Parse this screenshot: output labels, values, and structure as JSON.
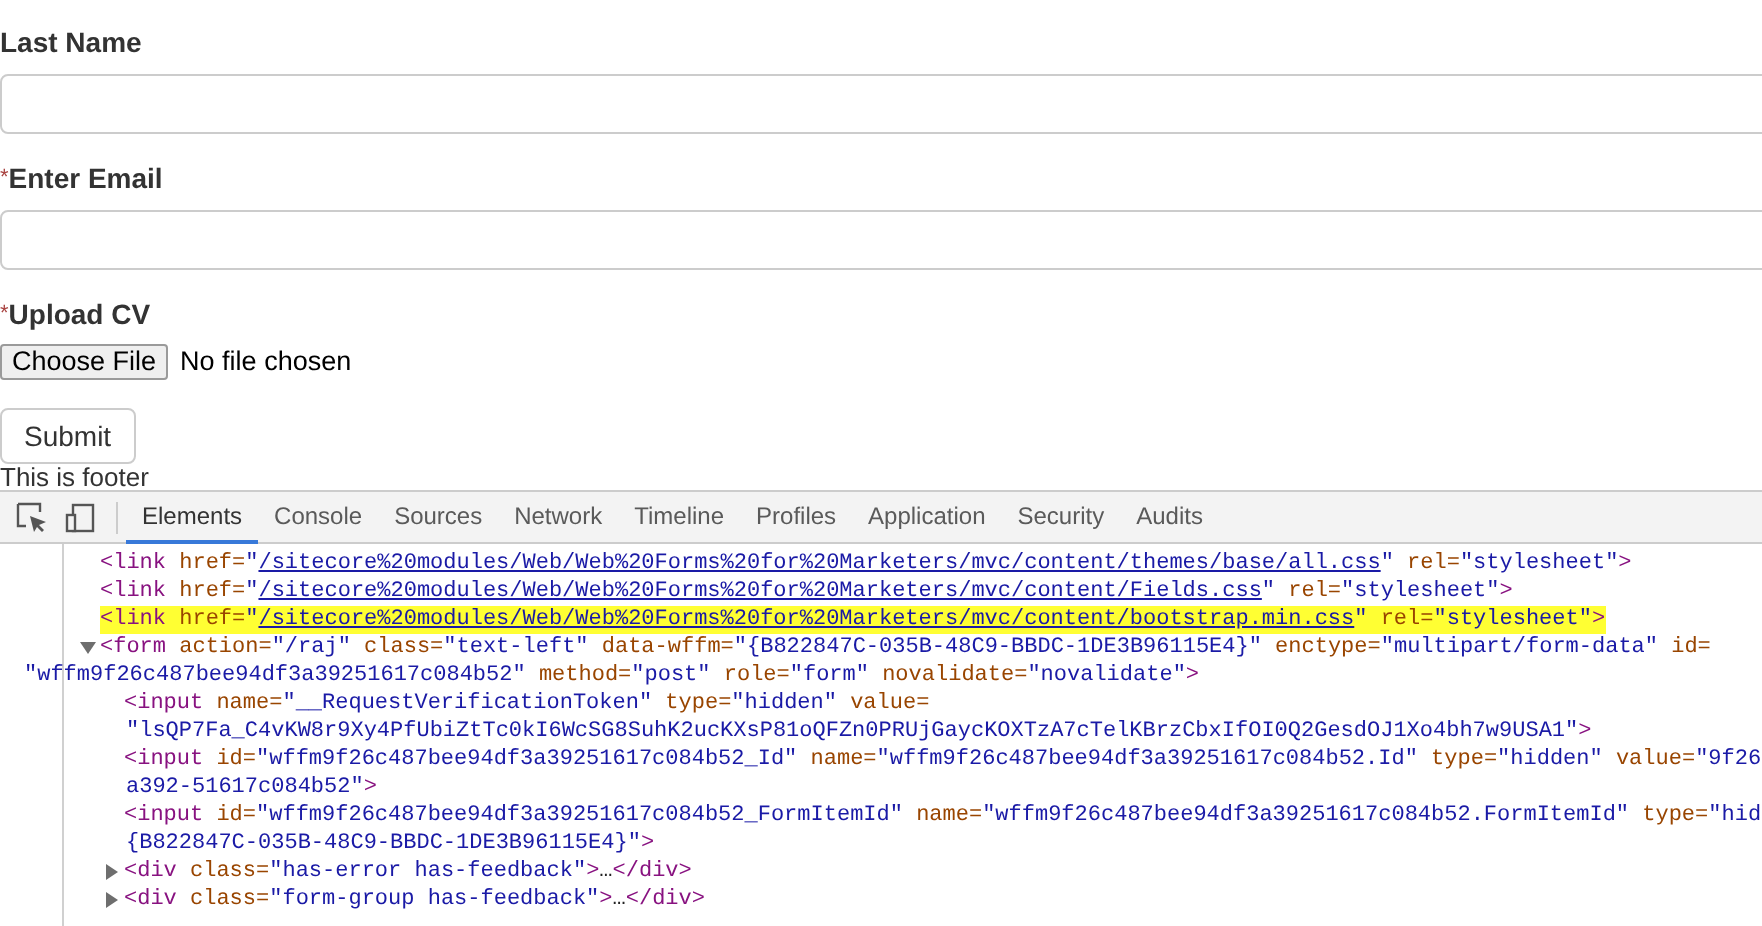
{
  "form": {
    "fields": [
      {
        "kind": "text",
        "label": "Last Name"
      },
      {
        "kind": "text",
        "label": "Enter Email",
        "required_mark": "*"
      },
      {
        "kind": "file",
        "label": "Upload CV",
        "required_mark": "*",
        "button": "Choose File",
        "status": "No file chosen"
      }
    ],
    "submit": "Submit",
    "footer": "This is footer"
  },
  "devtools": {
    "tabs": [
      {
        "label": "Elements",
        "selected": true
      },
      {
        "label": "Console",
        "selected": false
      },
      {
        "label": "Sources",
        "selected": false
      },
      {
        "label": "Network",
        "selected": false
      },
      {
        "label": "Timeline",
        "selected": false
      },
      {
        "label": "Profiles",
        "selected": false
      },
      {
        "label": "Application",
        "selected": false
      },
      {
        "label": "Security",
        "selected": false
      },
      {
        "label": "Audits",
        "selected": false
      }
    ],
    "nodes": [
      {
        "selected": false,
        "lines": [
          [
            {
              "kind": "tag",
              "text": "<link"
            },
            {
              "kind": "attr",
              "text": " href="
            },
            {
              "kind": "value",
              "text": "\""
            },
            {
              "kind": "link",
              "text": "/sitecore%20modules/Web/Web%20Forms%20for%20Marketers/mvc/content/themes/base/all.css"
            },
            {
              "kind": "value",
              "text": "\""
            },
            {
              "kind": "attr",
              "text": " rel="
            },
            {
              "kind": "value",
              "text": "\"stylesheet\""
            },
            {
              "kind": "tag",
              "text": ">"
            }
          ]
        ]
      },
      {
        "selected": false,
        "lines": [
          [
            {
              "kind": "tag",
              "text": "<link"
            },
            {
              "kind": "attr",
              "text": " href="
            },
            {
              "kind": "value",
              "text": "\""
            },
            {
              "kind": "link",
              "text": "/sitecore%20modules/Web/Web%20Forms%20for%20Marketers/mvc/content/Fields.css"
            },
            {
              "kind": "value",
              "text": "\""
            },
            {
              "kind": "attr",
              "text": " rel="
            },
            {
              "kind": "value",
              "text": "\"stylesheet\""
            },
            {
              "kind": "tag",
              "text": ">"
            }
          ]
        ]
      },
      {
        "selected": true,
        "lines": [
          [
            {
              "kind": "tag",
              "text": "<link"
            },
            {
              "kind": "attr",
              "text": " href="
            },
            {
              "kind": "value",
              "text": "\""
            },
            {
              "kind": "link",
              "text": "/sitecore%20modules/Web/Web%20Forms%20for%20Marketers/mvc/content/bootstrap.min.css"
            },
            {
              "kind": "value",
              "text": "\""
            },
            {
              "kind": "attr",
              "text": " rel="
            },
            {
              "kind": "value",
              "text": "\"stylesheet\""
            },
            {
              "kind": "tag",
              "text": ">"
            }
          ]
        ]
      },
      {
        "selected": false,
        "expanded": true,
        "lines": [
          [
            {
              "kind": "tag",
              "text": "<form"
            },
            {
              "kind": "attr",
              "text": " action="
            },
            {
              "kind": "value",
              "text": "\"/raj\""
            },
            {
              "kind": "attr",
              "text": " class="
            },
            {
              "kind": "value",
              "text": "\"text-left\""
            },
            {
              "kind": "attr",
              "text": " data-wffm="
            },
            {
              "kind": "value",
              "text": "\"{B822847C-035B-48C9-BBDC-1DE3B96115E4}\""
            },
            {
              "kind": "attr",
              "text": " enctype="
            },
            {
              "kind": "value",
              "text": "\"multipart/form-data\""
            },
            {
              "kind": "attr",
              "text": " id="
            }
          ],
          [
            {
              "kind": "value",
              "text": "\"wffm9f26c487bee94df3a39251617c084b52\""
            },
            {
              "kind": "attr",
              "text": " method="
            },
            {
              "kind": "value",
              "text": "\"post\""
            },
            {
              "kind": "attr",
              "text": " role="
            },
            {
              "kind": "value",
              "text": "\"form\""
            },
            {
              "kind": "attr",
              "text": " novalidate="
            },
            {
              "kind": "value",
              "text": "\"novalidate\""
            },
            {
              "kind": "tag",
              "text": ">"
            }
          ]
        ],
        "children": [
          {
            "selected": false,
            "lines": [
              [
                {
                  "kind": "tag",
                  "text": "<input"
                },
                {
                  "kind": "attr",
                  "text": " name="
                },
                {
                  "kind": "value",
                  "text": "\"__RequestVerificationToken\""
                },
                {
                  "kind": "attr",
                  "text": " type="
                },
                {
                  "kind": "value",
                  "text": "\"hidden\""
                },
                {
                  "kind": "attr",
                  "text": " value="
                }
              ],
              [
                {
                  "kind": "value",
                  "text": "\"lsQP7Fa_C4vKW8r9Xy4PfUbiZtTc0kI6WcSG8SuhK2ucKXsP81oQFZn0PRUjGaycKOXTzA7cTelKBrzCbxIfOI0Q2GesdOJ1Xo4bh7w9USA1\""
                },
                {
                  "kind": "tag",
                  "text": ">"
                }
              ]
            ]
          },
          {
            "selected": false,
            "lines": [
              [
                {
                  "kind": "tag",
                  "text": "<input"
                },
                {
                  "kind": "attr",
                  "text": " id="
                },
                {
                  "kind": "value",
                  "text": "\"wffm9f26c487bee94df3a39251617c084b52_Id\""
                },
                {
                  "kind": "attr",
                  "text": " name="
                },
                {
                  "kind": "value",
                  "text": "\"wffm9f26c487bee94df3a39251617c084b52.Id\""
                },
                {
                  "kind": "attr",
                  "text": " type="
                },
                {
                  "kind": "value",
                  "text": "\"hidden\""
                },
                {
                  "kind": "attr",
                  "text": " value="
                },
                {
                  "kind": "value",
                  "text": "\"9f26"
                }
              ],
              [
                {
                  "kind": "value",
                  "text": "a392-51617c084b52\""
                },
                {
                  "kind": "tag",
                  "text": ">"
                }
              ]
            ]
          },
          {
            "selected": false,
            "lines": [
              [
                {
                  "kind": "tag",
                  "text": "<input"
                },
                {
                  "kind": "attr",
                  "text": " id="
                },
                {
                  "kind": "value",
                  "text": "\"wffm9f26c487bee94df3a39251617c084b52_FormItemId\""
                },
                {
                  "kind": "attr",
                  "text": " name="
                },
                {
                  "kind": "value",
                  "text": "\"wffm9f26c487bee94df3a39251617c084b52.FormItemId\""
                },
                {
                  "kind": "attr",
                  "text": " type="
                },
                {
                  "kind": "value",
                  "text": "\"hid"
                }
              ],
              [
                {
                  "kind": "value",
                  "text": "{B822847C-035B-48C9-BBDC-1DE3B96115E4}\""
                },
                {
                  "kind": "tag",
                  "text": ">"
                }
              ]
            ]
          },
          {
            "selected": false,
            "expanded": false,
            "lines": [
              [
                {
                  "kind": "tag",
                  "text": "<div"
                },
                {
                  "kind": "attr",
                  "text": " class="
                },
                {
                  "kind": "value",
                  "text": "\"has-error has-feedback\""
                },
                {
                  "kind": "tag",
                  "text": ">"
                },
                {
                  "kind": "text",
                  "text": "…"
                },
                {
                  "kind": "tag",
                  "text": "</div>"
                }
              ]
            ]
          },
          {
            "selected": false,
            "expanded": false,
            "lines": [
              [
                {
                  "kind": "tag",
                  "text": "<div"
                },
                {
                  "kind": "attr",
                  "text": " class="
                },
                {
                  "kind": "value",
                  "text": "\"form-group has-feedback\""
                },
                {
                  "kind": "tag",
                  "text": ">"
                },
                {
                  "kind": "text",
                  "text": "…"
                },
                {
                  "kind": "tag",
                  "text": "</div>"
                }
              ]
            ]
          }
        ]
      }
    ]
  }
}
